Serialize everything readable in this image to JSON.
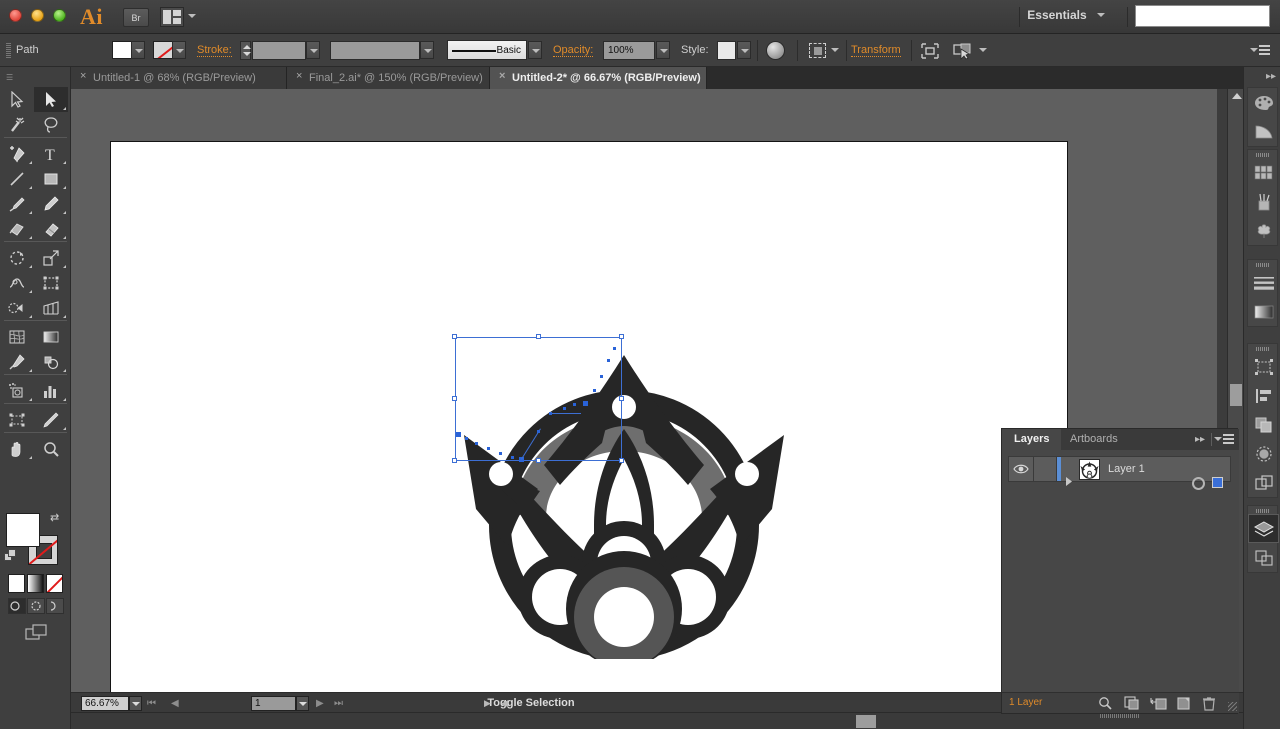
{
  "app": {
    "name": "Adobe Illustrator",
    "logo_text": "Ai",
    "bridge_label": "Br",
    "workspace": "Essentials",
    "search_value": ""
  },
  "window_controls": {
    "close": "close-button",
    "minimize": "minimize-button",
    "zoom": "maximize-button"
  },
  "control_bar": {
    "object_type": "Path",
    "fill_swatch": "white",
    "stroke_swatch": "none",
    "stroke_label": "Stroke:",
    "stroke_weight": "",
    "stroke_profile": "",
    "brush_definition": "Basic",
    "opacity_label": "Opacity:",
    "opacity_value": "100%",
    "style_label": "Style:",
    "transform_label": "Transform",
    "align_icon": "align-icon",
    "select_similar_icon": "select-similar-icon",
    "panel_menu_icon": "panel-menu-icon"
  },
  "tabs": [
    {
      "label": "Untitled-1 @ 68% (RGB/Preview)",
      "active": false,
      "close": "×"
    },
    {
      "label": "Final_2.ai* @ 150% (RGB/Preview)",
      "active": false,
      "close": "×"
    },
    {
      "label": "Untitled-2* @ 66.67% (RGB/Preview)",
      "active": true,
      "close": "×"
    }
  ],
  "toolbar": {
    "tools": [
      {
        "name": "selection-tool",
        "selected": false,
        "corner": false
      },
      {
        "name": "direct-selection-tool",
        "selected": true,
        "corner": true
      },
      {
        "name": "magic-wand-tool",
        "selected": false,
        "corner": false
      },
      {
        "name": "lasso-tool",
        "selected": false,
        "corner": false
      },
      {
        "name": "pen-tool",
        "selected": false,
        "corner": true
      },
      {
        "name": "type-tool",
        "selected": false,
        "corner": true
      },
      {
        "name": "line-segment-tool",
        "selected": false,
        "corner": true
      },
      {
        "name": "rectangle-tool",
        "selected": false,
        "corner": true
      },
      {
        "name": "paintbrush-tool",
        "selected": false,
        "corner": true
      },
      {
        "name": "pencil-tool",
        "selected": false,
        "corner": true
      },
      {
        "name": "blob-brush-tool",
        "selected": false,
        "corner": true
      },
      {
        "name": "eraser-tool",
        "selected": false,
        "corner": true
      },
      {
        "name": "rotate-tool",
        "selected": false,
        "corner": true
      },
      {
        "name": "scale-tool",
        "selected": false,
        "corner": true
      },
      {
        "name": "width-tool",
        "selected": false,
        "corner": true
      },
      {
        "name": "free-transform-tool",
        "selected": false,
        "corner": false
      },
      {
        "name": "shape-builder-tool",
        "selected": false,
        "corner": true
      },
      {
        "name": "perspective-grid-tool",
        "selected": false,
        "corner": true
      },
      {
        "name": "mesh-tool",
        "selected": false,
        "corner": false
      },
      {
        "name": "gradient-tool",
        "selected": false,
        "corner": false
      },
      {
        "name": "eyedropper-tool",
        "selected": false,
        "corner": true
      },
      {
        "name": "blend-tool",
        "selected": false,
        "corner": true
      },
      {
        "name": "symbol-sprayer-tool",
        "selected": false,
        "corner": true
      },
      {
        "name": "column-graph-tool",
        "selected": false,
        "corner": true
      },
      {
        "name": "artboard-tool",
        "selected": false,
        "corner": false
      },
      {
        "name": "slice-tool",
        "selected": false,
        "corner": true
      },
      {
        "name": "hand-tool",
        "selected": false,
        "corner": true
      },
      {
        "name": "zoom-tool",
        "selected": false,
        "corner": false
      }
    ],
    "fill_color": "#ffffff",
    "stroke_color": "none",
    "color_modes": [
      "color-mode",
      "gradient-mode",
      "none-mode"
    ],
    "draw_modes": [
      "draw-normal",
      "draw-behind",
      "draw-inside"
    ],
    "screen_mode": "screen-mode-button"
  },
  "canvas": {
    "background": "#5f5f5f",
    "artboard_background": "#ffffff",
    "selection_color": "#3d6fd4",
    "artwork_colors": {
      "primary": "#262626",
      "accent_gray": "#6e6e6e",
      "ring_gray": "#555555"
    }
  },
  "status_bar": {
    "zoom_level": "66.67%",
    "page_number": "1",
    "status_text": "Toggle Selection",
    "first_page_icon": "first-page-icon",
    "prev_page_icon": "previous-page-icon",
    "next_page_icon": "next-page-icon",
    "last_page_icon": "last-page-icon"
  },
  "dock": {
    "collapse_icon": "collapse-panels-icon",
    "groups": [
      {
        "icons": [
          {
            "name": "color-panel-icon",
            "selected": false
          },
          {
            "name": "color-guide-panel-icon",
            "selected": false
          }
        ],
        "grip": false
      },
      {
        "icons": [
          {
            "name": "swatches-panel-icon",
            "selected": false
          },
          {
            "name": "brushes-panel-icon",
            "selected": false
          },
          {
            "name": "symbols-panel-icon",
            "selected": false
          }
        ],
        "grip": true
      },
      {
        "icons": [
          {
            "name": "stroke-panel-icon",
            "selected": false
          },
          {
            "name": "gradient-panel-icon",
            "selected": false
          }
        ],
        "grip": true
      },
      {
        "icons": [
          {
            "name": "artboards-panel-icon",
            "selected": false
          },
          {
            "name": "align-panel-icon",
            "selected": false
          },
          {
            "name": "pathfinder-panel-icon",
            "selected": false
          },
          {
            "name": "transparency-panel-icon",
            "selected": false
          },
          {
            "name": "appearance-panel-icon",
            "selected": false
          }
        ],
        "grip": true
      },
      {
        "icons": [
          {
            "name": "layers-panel-icon",
            "selected": true
          },
          {
            "name": "links-panel-icon",
            "selected": false
          }
        ],
        "grip": true
      }
    ]
  },
  "layers_panel": {
    "tabs": [
      {
        "label": "Layers",
        "active": true
      },
      {
        "label": "Artboards",
        "active": false
      }
    ],
    "collapse_icon": "expand-panel-icon",
    "menu_icon": "panel-menu-icon",
    "rows": [
      {
        "name": "Layer 1",
        "visible": true,
        "locked": false,
        "expanded": false,
        "selected": true,
        "target_icon": "target-circle-icon",
        "selection_square_color": "#3a6fd8"
      }
    ],
    "footer": {
      "count_label": "1 Layer",
      "icons": [
        "locate-object-icon",
        "make-clipping-mask-icon",
        "create-new-sublayer-icon",
        "create-new-layer-icon",
        "delete-selection-icon"
      ]
    }
  },
  "scrollbars": {
    "vertical_up_icon": "scroll-up-arrow",
    "horizontal_thumb": "horizontal-scroll-thumb",
    "vertical_thumb": "vertical-scroll-thumb"
  }
}
